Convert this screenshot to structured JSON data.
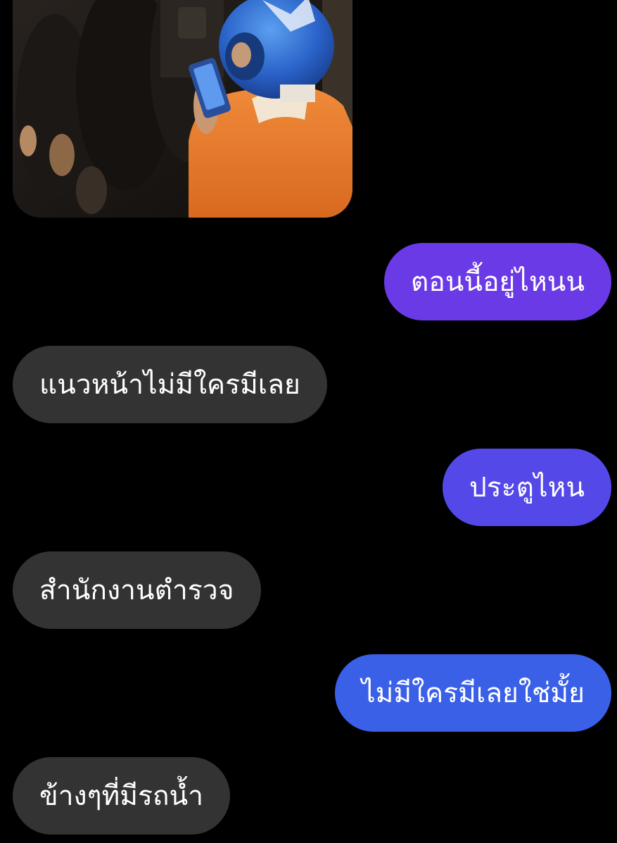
{
  "conversation": {
    "photo": {
      "description_icon": "image-icon"
    },
    "messages": [
      {
        "direction": "sent",
        "text": "ตอนนี้อยู่ไหนน",
        "color": "#6a3ae6"
      },
      {
        "direction": "received",
        "text": "แนวหน้าไม่มีใครมีเลย",
        "color": "#333333"
      },
      {
        "direction": "sent",
        "text": "ประตูไหน",
        "color": "#5448e8"
      },
      {
        "direction": "received",
        "text": "สำนักงานตำรวจ",
        "color": "#333333"
      },
      {
        "direction": "sent",
        "text": "ไม่มีใครมีเลยใช่มั้ย",
        "color": "#3a60e8"
      },
      {
        "direction": "received",
        "text": "ข้างๆที่มีรถน้ำ",
        "color": "#333333"
      }
    ]
  }
}
